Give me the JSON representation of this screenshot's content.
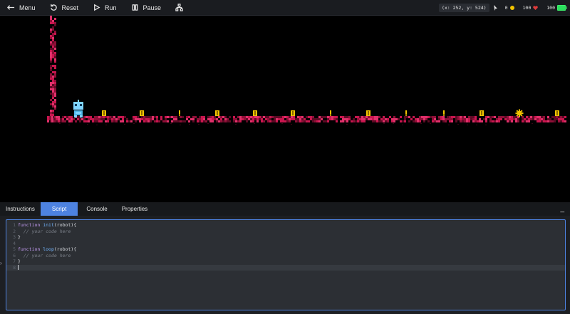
{
  "toolbar": {
    "menu_label": "Menu",
    "reset_label": "Reset",
    "run_label": "Run",
    "pause_label": "Pause"
  },
  "status": {
    "coords": "(x: 252, y: 524)",
    "coins": "0",
    "health": "100",
    "battery": "100"
  },
  "colors": {
    "accent": "#4d82e0",
    "wall": "#c8164e",
    "coin": "#f2c400",
    "robot": "#7ed4ff",
    "battery": "#2be05e"
  },
  "game": {
    "items": [
      "coin",
      "coin",
      "key",
      "coin",
      "coin",
      "coin",
      "key",
      "coin",
      "key",
      "key",
      "coin",
      "gear",
      "coin"
    ]
  },
  "panel": {
    "tabs": [
      "Instructions",
      "Script",
      "Console",
      "Properties"
    ],
    "active_tab": "Script",
    "collapse_label": "_"
  },
  "editor": {
    "line_numbers": [
      "1",
      "2",
      "3",
      "4",
      "5",
      "6",
      "7",
      "8"
    ],
    "lines": [
      "function init(robot){",
      "  // your code here",
      "}",
      "",
      "function loop(robot){",
      "  // your code here",
      "}",
      ""
    ]
  }
}
